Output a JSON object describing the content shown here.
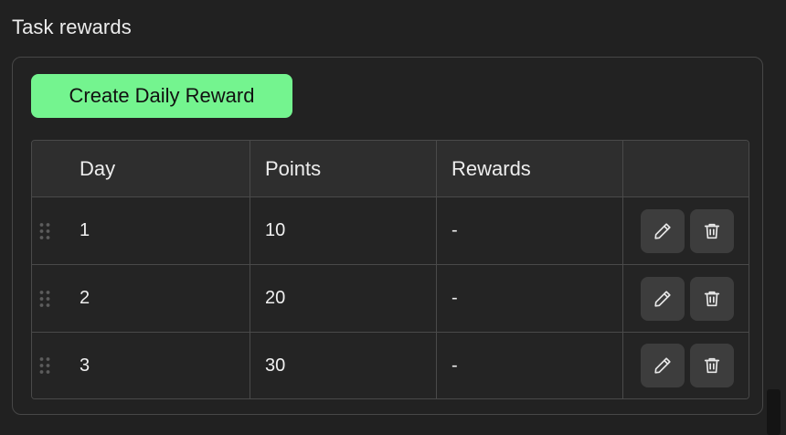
{
  "section": {
    "title": "Task rewards"
  },
  "create_button": {
    "label": "Create Daily Reward"
  },
  "table": {
    "columns": [
      "Day",
      "Points",
      "Rewards",
      ""
    ],
    "rows": [
      {
        "day": "1",
        "points": "10",
        "rewards": "-"
      },
      {
        "day": "2",
        "points": "20",
        "rewards": "-"
      },
      {
        "day": "3",
        "points": "30",
        "rewards": "-"
      }
    ]
  },
  "icons": {
    "drag": "drag-handle-icon",
    "edit": "pencil-icon",
    "delete": "trash-icon"
  },
  "colors": {
    "background": "#212121",
    "accent": "#74f48f",
    "header": "#2e2e2e",
    "border": "#4a4a4a",
    "action_button": "#3d3d3d"
  }
}
